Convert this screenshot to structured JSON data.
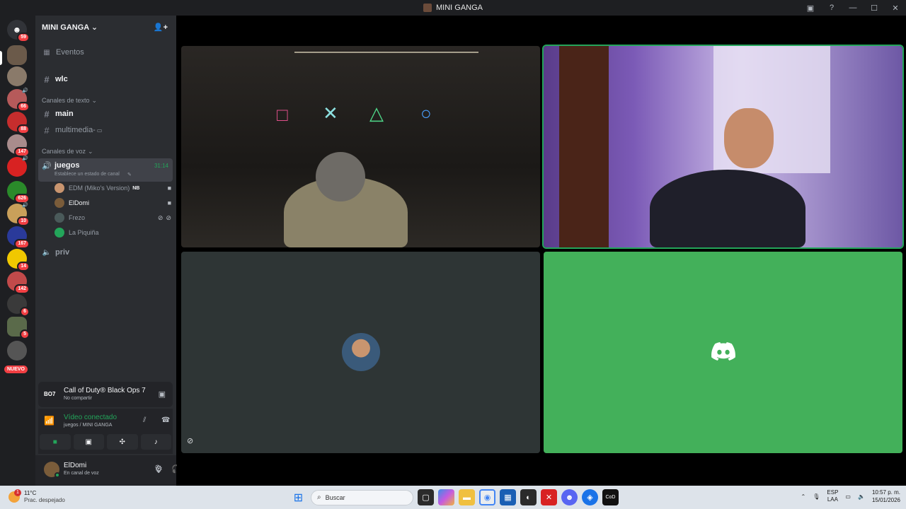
{
  "window": {
    "title": "MINI GANGA"
  },
  "guilds": {
    "badges": [
      "59",
      "66",
      "88",
      "147",
      "626",
      "10",
      "167",
      "14",
      "142",
      "6",
      "5"
    ],
    "new_label": "NUEVO"
  },
  "server": {
    "name": "MINI GANGA",
    "events_label": "Eventos",
    "channel_wlc": "wlc",
    "cat_text": "Canales de texto",
    "channel_main": "main",
    "channel_multimedia": "multimedia-",
    "cat_voice": "Canales de voz",
    "voice_juegos": {
      "name": "juegos",
      "time": "31:14",
      "status": "Establece un estado de canal"
    },
    "voice_users": [
      {
        "name": "EDM (Miko's Version)",
        "tag": "NB"
      },
      {
        "name": "ElDomi"
      },
      {
        "name": "Frezo"
      },
      {
        "name": "La Piquiña"
      }
    ],
    "channel_priv": "priv"
  },
  "activity": {
    "game": "Call of Duty® Black Ops 7",
    "sub": "No compartir",
    "logo": "BO7"
  },
  "voice_connection": {
    "title": "Vídeo conectado",
    "sub": "juegos / MINI GANGA"
  },
  "user": {
    "name": "ElDomi",
    "status": "En canal de voz"
  },
  "taskbar": {
    "temp": "11°C",
    "weather": "Prac. despejado",
    "search_placeholder": "Buscar",
    "lang": "ESP",
    "lang2": "LAA",
    "time": "10:57 p. m.",
    "date": "15/01/2026",
    "weather_alert": "1"
  }
}
